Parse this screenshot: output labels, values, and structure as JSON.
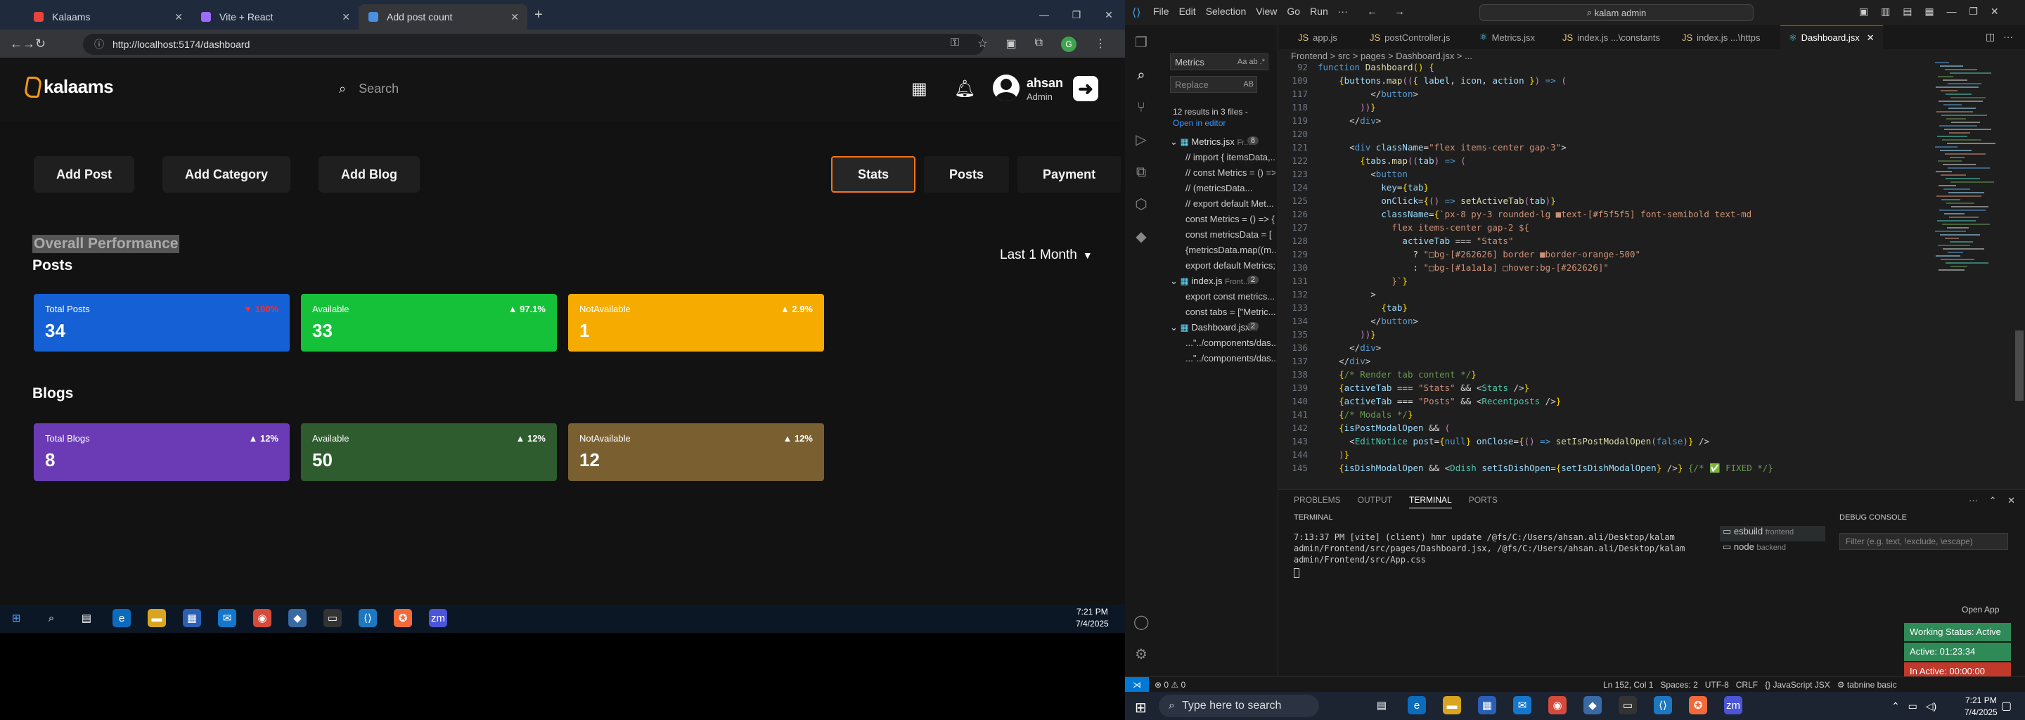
{
  "chrome": {
    "tabs": [
      {
        "title": "Kalaams",
        "color": "#e8443a"
      },
      {
        "title": "Vite + React",
        "color": "#9b6bff"
      },
      {
        "title": "Add post count",
        "color": "#4a90e2"
      }
    ],
    "url": "http://localhost:5174/dashboard",
    "profile_initial": "G"
  },
  "app": {
    "logo": "kalaams",
    "search_placeholder": "Search",
    "user_name": "ahsan",
    "user_role": "Admin",
    "actions": [
      "Add Post",
      "Add Category",
      "Add Blog"
    ],
    "tabs": [
      "Stats",
      "Posts",
      "Payment"
    ],
    "active_tab": "Stats",
    "overall_label": "Overall Performance",
    "range": "Last 1 Month",
    "posts": {
      "title": "Posts",
      "cards": [
        {
          "label": "Total Posts",
          "value": "34",
          "pct": "100%",
          "color": "#1560d4",
          "pct_color": "#ff2d2d",
          "arrow": "▼"
        },
        {
          "label": "Available",
          "value": "33",
          "pct": "97.1%",
          "color": "#16c13a",
          "pct_color": "#ffffff",
          "arrow": "▲"
        },
        {
          "label": "NotAvailable",
          "value": "1",
          "pct": "2.9%",
          "color": "#f5ab00",
          "pct_color": "#ffffff",
          "arrow": "▲"
        }
      ]
    },
    "blogs": {
      "title": "Blogs",
      "cards": [
        {
          "label": "Total Blogs",
          "value": "8",
          "pct": "12%",
          "color": "#6a3bb5",
          "pct_color": "#ffffff",
          "arrow": "▲"
        },
        {
          "label": "Available",
          "value": "50",
          "pct": "12%",
          "color": "#2e5c2e",
          "pct_color": "#ffffff",
          "arrow": "▲"
        },
        {
          "label": "NotAvailable",
          "value": "12",
          "pct": "12%",
          "color": "#7a6030",
          "pct_color": "#ffffff",
          "arrow": "▲"
        }
      ]
    }
  },
  "taskbar_left": {
    "time": "7:21 PM",
    "date": "7/4/2025"
  },
  "vscode": {
    "menu": [
      "File",
      "Edit",
      "Selection",
      "View",
      "Go",
      "Run",
      "···"
    ],
    "command_center": "kalam admin",
    "search": {
      "query": "Metrics",
      "replace": "Replace",
      "summary": "12 results in 3 files -",
      "open_editor": "Open in editor"
    },
    "results": [
      {
        "text": "Metrics.jsx",
        "extra": "Fr...",
        "count": "8",
        "file": true
      },
      {
        "text": "// import { itemsData,..."
      },
      {
        "text": "// const Metrics = () =>"
      },
      {
        "text": "//       (metricsData..."
      },
      {
        "text": "// export default Met..."
      },
      {
        "text": "const Metrics = () => {"
      },
      {
        "text": "const metricsData = ["
      },
      {
        "text": "{metricsData.map((m..."
      },
      {
        "text": "export default Metrics;"
      },
      {
        "text": "index.js",
        "extra": "Front...",
        "count": "2",
        "file": true
      },
      {
        "text": "export const metrics..."
      },
      {
        "text": "const tabs = [\"Metric..."
      },
      {
        "text": "Dashboard.jsx...",
        "count": "2",
        "file": true
      },
      {
        "text": "...\"../components/das..."
      },
      {
        "text": "...\"../components/das..."
      }
    ],
    "editor_tabs": [
      "app.js",
      "postController.js",
      "Metrics.jsx",
      "index.js ...\\constants",
      "index.js ...\\https",
      "Dashboard.jsx"
    ],
    "breadcrumb": "Frontend > src > pages > Dashboard.jsx > ...",
    "code_lines": [
      {
        "n": "92",
        "html": "<span class='kw'>function</span> <span class='fn'>Dashboard</span><span class='br'>()</span> <span class='br'>{</span>"
      },
      {
        "n": "109",
        "html": "    <span class='br'>{</span><span class='vr'>buttons</span>.<span class='fn'>map</span><span class='pl'>((</span><span class='br'>{</span> <span class='vr'>label</span>, <span class='vr'>icon</span>, <span class='vr'>action</span> <span class='br'>}</span><span class='pl'>)</span> <span class='kw'>=&gt;</span> <span class='pl'>(</span>"
      },
      {
        "n": "117",
        "html": "          <span class='tx'>&lt;/</span><span class='kw'>button</span><span class='tx'>&gt;</span>"
      },
      {
        "n": "118",
        "html": "        <span class='pl'>))</span><span class='br'>}</span>"
      },
      {
        "n": "119",
        "html": "      <span class='tx'>&lt;/</span><span class='kw'>div</span><span class='tx'>&gt;</span>"
      },
      {
        "n": "120",
        "html": ""
      },
      {
        "n": "121",
        "html": "      <span class='tx'>&lt;</span><span class='kw'>div</span> <span class='vr'>className</span>=<span class='st'>\"flex items-center gap-3\"</span><span class='tx'>&gt;</span>"
      },
      {
        "n": "122",
        "html": "        <span class='br'>{</span><span class='vr'>tabs</span>.<span class='fn'>map</span><span class='pl'>((</span><span class='vr'>tab</span><span class='pl'>)</span> <span class='kw'>=&gt;</span> <span class='pl'>(</span>"
      },
      {
        "n": "123",
        "html": "          <span class='tx'>&lt;</span><span class='kw'>button</span>"
      },
      {
        "n": "124",
        "html": "            <span class='vr'>key</span>=<span class='br'>{</span><span class='vr'>tab</span><span class='br'>}</span>"
      },
      {
        "n": "125",
        "html": "            <span class='vr'>onClick</span>=<span class='br'>{</span><span class='pl'>()</span> <span class='kw'>=&gt;</span> <span class='fn'>setActiveTab</span><span class='pl'>(</span><span class='vr'>tab</span><span class='pl'>)</span><span class='br'>}</span>"
      },
      {
        "n": "126",
        "html": "            <span class='vr'>className</span>=<span class='br'>{</span><span class='st'>`px-8 py-3 rounded-lg ■text-[#f5f5f5] font-semibold text-md</span>"
      },
      {
        "n": "127",
        "html": "              <span class='st'>flex items-center gap-2 ${</span>"
      },
      {
        "n": "128",
        "html": "                <span class='vr'>activeTab</span> === <span class='st'>\"Stats\"</span>"
      },
      {
        "n": "129",
        "html": "                  ? <span class='st'>\"□bg-[#262626] border ■border-orange-500\"</span>"
      },
      {
        "n": "130",
        "html": "                  : <span class='st'>\"□bg-[#1a1a1a] □hover:bg-[#262626]\"</span>"
      },
      {
        "n": "131",
        "html": "              <span class='st'>}`</span><span class='br'>}</span>"
      },
      {
        "n": "132",
        "html": "          <span class='tx'>&gt;</span>"
      },
      {
        "n": "133",
        "html": "            <span class='br'>{</span><span class='vr'>tab</span><span class='br'>}</span>"
      },
      {
        "n": "134",
        "html": "          <span class='tx'>&lt;/</span><span class='kw'>button</span><span class='tx'>&gt;</span>"
      },
      {
        "n": "135",
        "html": "        <span class='pl'>))</span><span class='br'>}</span>"
      },
      {
        "n": "136",
        "html": "      <span class='tx'>&lt;/</span><span class='kw'>div</span><span class='tx'>&gt;</span>"
      },
      {
        "n": "137",
        "html": "    <span class='tx'>&lt;/</span><span class='kw'>div</span><span class='tx'>&gt;</span>"
      },
      {
        "n": "138",
        "html": "    <span class='br'>{</span><span class='cm'>/* Render tab content */</span><span class='br'>}</span>"
      },
      {
        "n": "139",
        "html": "    <span class='br'>{</span><span class='vr'>activeTab</span> === <span class='st'>\"Stats\"</span> &amp;&amp; <span class='tx'>&lt;</span><span class='tg'>Stats</span> <span class='tx'>/&gt;</span><span class='br'>}</span>"
      },
      {
        "n": "140",
        "html": "    <span class='br'>{</span><span class='vr'>activeTab</span> === <span class='st'>\"Posts\"</span> &amp;&amp; <span class='tx'>&lt;</span><span class='tg'>Recentposts</span> <span class='tx'>/&gt;</span><span class='br'>}</span>"
      },
      {
        "n": "141",
        "html": "    <span class='br'>{</span><span class='cm'>/* Modals */</span><span class='br'>}</span>"
      },
      {
        "n": "142",
        "html": "    <span class='br'>{</span><span class='vr'>isPostModalOpen</span> &amp;&amp; <span class='pl'>(</span>"
      },
      {
        "n": "143",
        "html": "      <span class='tx'>&lt;</span><span class='tg'>EditNotice</span> <span class='vr'>post</span>=<span class='br'>{</span><span class='kw'>null</span><span class='br'>}</span> <span class='vr'>onClose</span>=<span class='br'>{</span><span class='pl'>()</span> <span class='kw'>=&gt;</span> <span class='fn'>setIsPostModalOpen</span><span class='pl'>(</span><span class='kw'>false</span><span class='pl'>)</span><span class='br'>}</span> <span class='tx'>/&gt;</span>"
      },
      {
        "n": "144",
        "html": "    <span class='pl'>)</span><span class='br'>}</span>"
      },
      {
        "n": "145",
        "html": "    <span class='br'>{</span><span class='vr'>isDishModalOpen</span> &amp;&amp; <span class='tx'>&lt;</span><span class='tg'>Ddish</span> <span class='vr'>setIsDishOpen</span>=<span class='br'>{</span><span class='vr'>setIsDishModalOpen</span><span class='br'>}</span> <span class='tx'>/&gt;</span><span class='br'>}</span> <span class='cm'>{/* ✅ FIXED */}</span>"
      }
    ],
    "panel_tabs": [
      "PROBLEMS",
      "OUTPUT",
      "TERMINAL",
      "PORTS"
    ],
    "terminal_label": "TERMINAL",
    "terminal_text": "7:13:37 PM [vite] (client) hmr update /@fs/C:/Users/ahsan.ali/Desktop/kalam admin/Frontend/src/pages/Dashboard.jsx, /@fs/C:/Users/ahsan.ali/Desktop/kalam admin/Frontend/src/App.css",
    "terminals": [
      {
        "name": "esbuild",
        "sub": "frontend"
      },
      {
        "name": "node",
        "sub": "backend"
      }
    ],
    "debug_label": "DEBUG CONSOLE",
    "debug_filter": "Filter (e.g. text, !exclude, \\escape)",
    "open_app": "Open App",
    "work_status": [
      {
        "text": "Working Status: Active",
        "color": "#2e8b57"
      },
      {
        "text": "Active: 01:23:34",
        "color": "#2e8b57"
      },
      {
        "text": "In Active: 00:00:00",
        "color": "#c0392b"
      }
    ],
    "status_left": "⊗ 0 ⚠ 0",
    "status_right": "Ln 152, Col 1   Spaces: 2   UTF-8   CRLF   {} JavaScript JSX   ⚙ tabnine basic"
  },
  "taskbar_right": {
    "search_placeholder": "Type here to search",
    "time": "7:21 PM",
    "date": "7/4/2025"
  }
}
